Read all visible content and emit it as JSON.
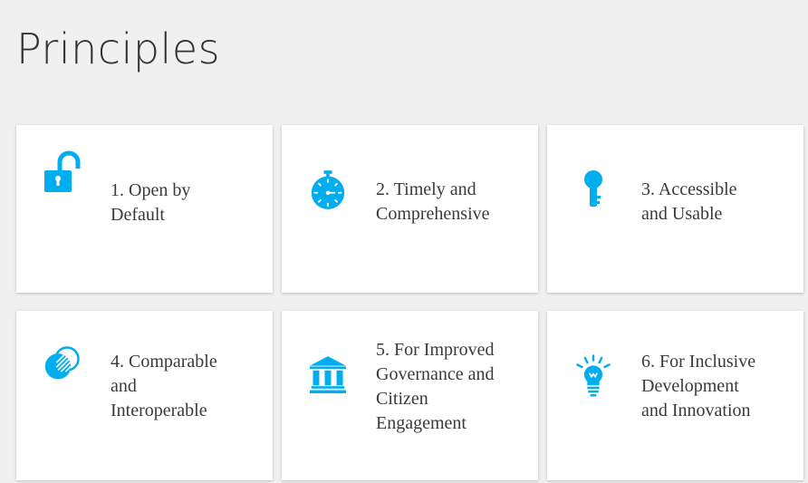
{
  "page": {
    "title": "Principles"
  },
  "theme": {
    "accent": "#00aeef",
    "card_bg": "#ffffff",
    "page_bg": "#f0f0f0",
    "text": "#3a3a3a"
  },
  "principles": [
    {
      "label": "1. Open by Default",
      "icon": "open-lock-icon"
    },
    {
      "label": "2. Timely and Comprehensive",
      "icon": "stopwatch-icon"
    },
    {
      "label": "3. Accessible and Usable",
      "icon": "key-icon"
    },
    {
      "label": "4. Comparable and Interoperable",
      "icon": "overlapping-circles-icon"
    },
    {
      "label": "5. For Improved Governance and Citizen Engagement",
      "icon": "government-building-icon"
    },
    {
      "label": "6. For Inclusive Development and Innovation",
      "icon": "lightbulb-icon"
    }
  ]
}
